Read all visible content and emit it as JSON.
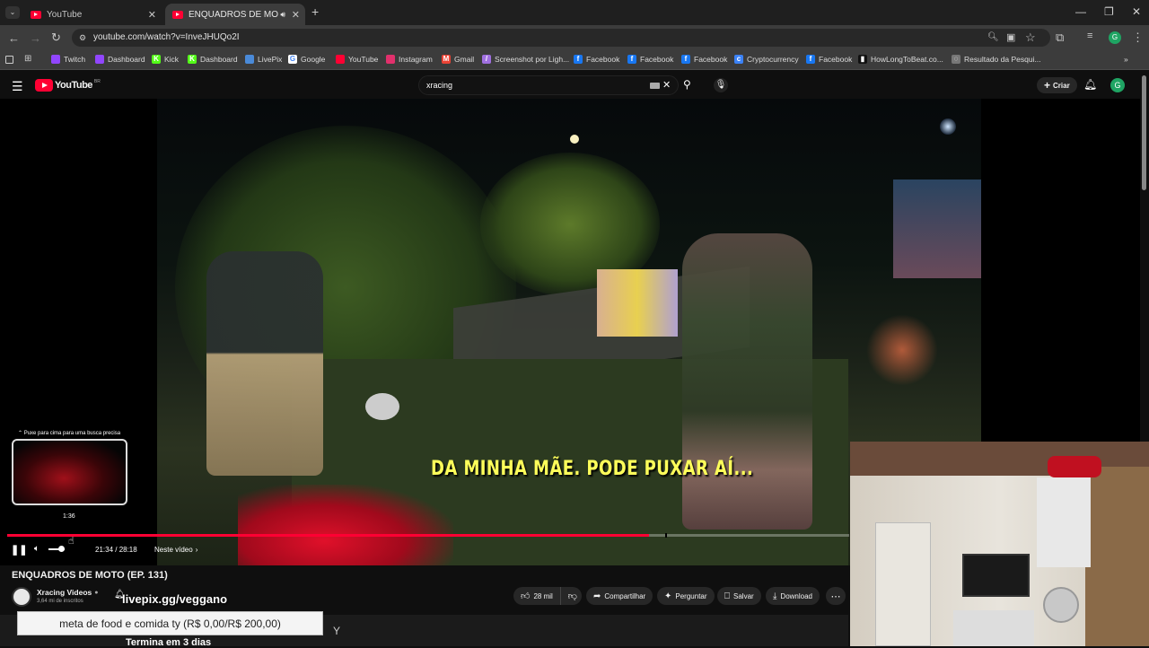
{
  "browser": {
    "tabs": [
      {
        "title": "YouTube",
        "active": false
      },
      {
        "title": "ENQUADROS DE MOTO (E",
        "active": true
      }
    ],
    "url": "youtube.com/watch?v=InveJHUQo2I",
    "bookmarks": [
      {
        "label": "Twitch",
        "icon": "twitch-icon",
        "color": "#9146ff",
        "glyph": ""
      },
      {
        "label": "Dashboard",
        "icon": "twitch-icon",
        "color": "#9146ff",
        "glyph": ""
      },
      {
        "label": "Kick",
        "icon": "kick-icon",
        "color": "#53fc18",
        "glyph": "K"
      },
      {
        "label": "Dashboard",
        "icon": "kick-icon",
        "color": "#53fc18",
        "glyph": "K"
      },
      {
        "label": "LivePix",
        "icon": "livepix-icon",
        "color": "#4a8ad8",
        "glyph": ""
      },
      {
        "label": "Google",
        "icon": "google-icon",
        "color": "#ffffff",
        "glyph": "G"
      },
      {
        "label": "YouTube",
        "icon": "youtube-icon",
        "color": "#ff0033",
        "glyph": ""
      },
      {
        "label": "Instagram",
        "icon": "instagram-icon",
        "color": "#e1306c",
        "glyph": ""
      },
      {
        "label": "Gmail",
        "icon": "gmail-icon",
        "color": "#ea4335",
        "glyph": "M"
      },
      {
        "label": "Screenshot por Ligh...",
        "icon": "lightshot-icon",
        "color": "#a070e0",
        "glyph": "/"
      },
      {
        "label": "Facebook",
        "icon": "facebook-icon",
        "color": "#1877f2",
        "glyph": "f"
      },
      {
        "label": "Facebook",
        "icon": "facebook-icon",
        "color": "#1877f2",
        "glyph": "f"
      },
      {
        "label": "Facebook",
        "icon": "facebook-icon",
        "color": "#1877f2",
        "glyph": "f"
      },
      {
        "label": "Cryptocurrency",
        "icon": "crypto-icon",
        "color": "#3b82f6",
        "glyph": "c"
      },
      {
        "label": "Facebook",
        "icon": "facebook-icon",
        "color": "#1877f2",
        "glyph": "f"
      },
      {
        "label": "HowLongToBeat.co...",
        "icon": "hltb-icon",
        "color": "#111111",
        "glyph": "▮"
      },
      {
        "label": "Resultado da Pesqui...",
        "icon": "globe-icon",
        "color": "#777777",
        "glyph": "◌"
      }
    ]
  },
  "youtube": {
    "logo_text": "YouTube",
    "logo_region": "BR",
    "search_value": "xracing",
    "create_label": "Criar",
    "avatar_letter": "G"
  },
  "player": {
    "subtitle": "DA MINHA MÃE. PODE PUXAR AÍ...",
    "seek_hint": "Puxe para cima para uma busca precisa",
    "preview_time": "1:36",
    "time": "21:34 / 28:18",
    "chapter": "Neste vídeo",
    "progress_fraction": 0.762
  },
  "video_info": {
    "title": "ENQUADROS DE MOTO (EP. 131)",
    "channel": "Xracing Videos",
    "subscribers": "3,64 mi de inscritos",
    "likes": "28 mil",
    "share": "Compartilhar",
    "ask": "Perguntar",
    "save": "Salvar",
    "download": "Download"
  },
  "stream_overlay": {
    "donation_url": "livepix.gg/veggano",
    "goal": "meta de food e comida ty (R$ 0,00/R$ 200,00)",
    "ending": "Termina em 3 dias"
  }
}
